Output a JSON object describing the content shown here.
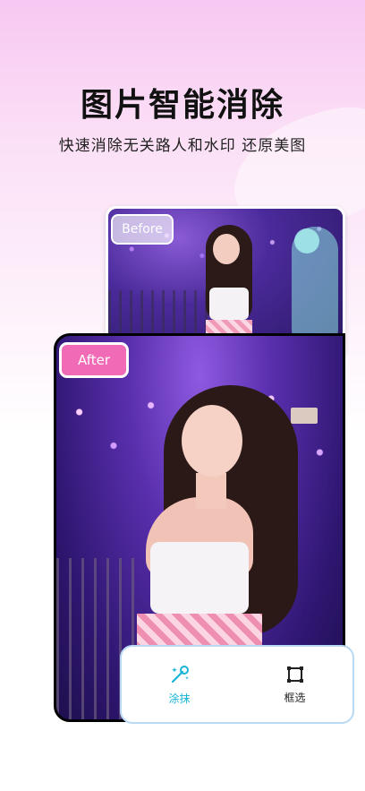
{
  "header": {
    "title": "图片智能消除",
    "subtitle": "快速消除无关路人和水印 还原美图"
  },
  "comparison": {
    "before_label": "Before",
    "after_label": "After"
  },
  "toolbar": {
    "tools": [
      {
        "label": "涂抹",
        "icon": "magic-wand-icon",
        "active": true,
        "color": "#17b4d6"
      },
      {
        "label": "框选",
        "icon": "selection-box-icon",
        "active": false,
        "color": "#222222"
      }
    ]
  }
}
